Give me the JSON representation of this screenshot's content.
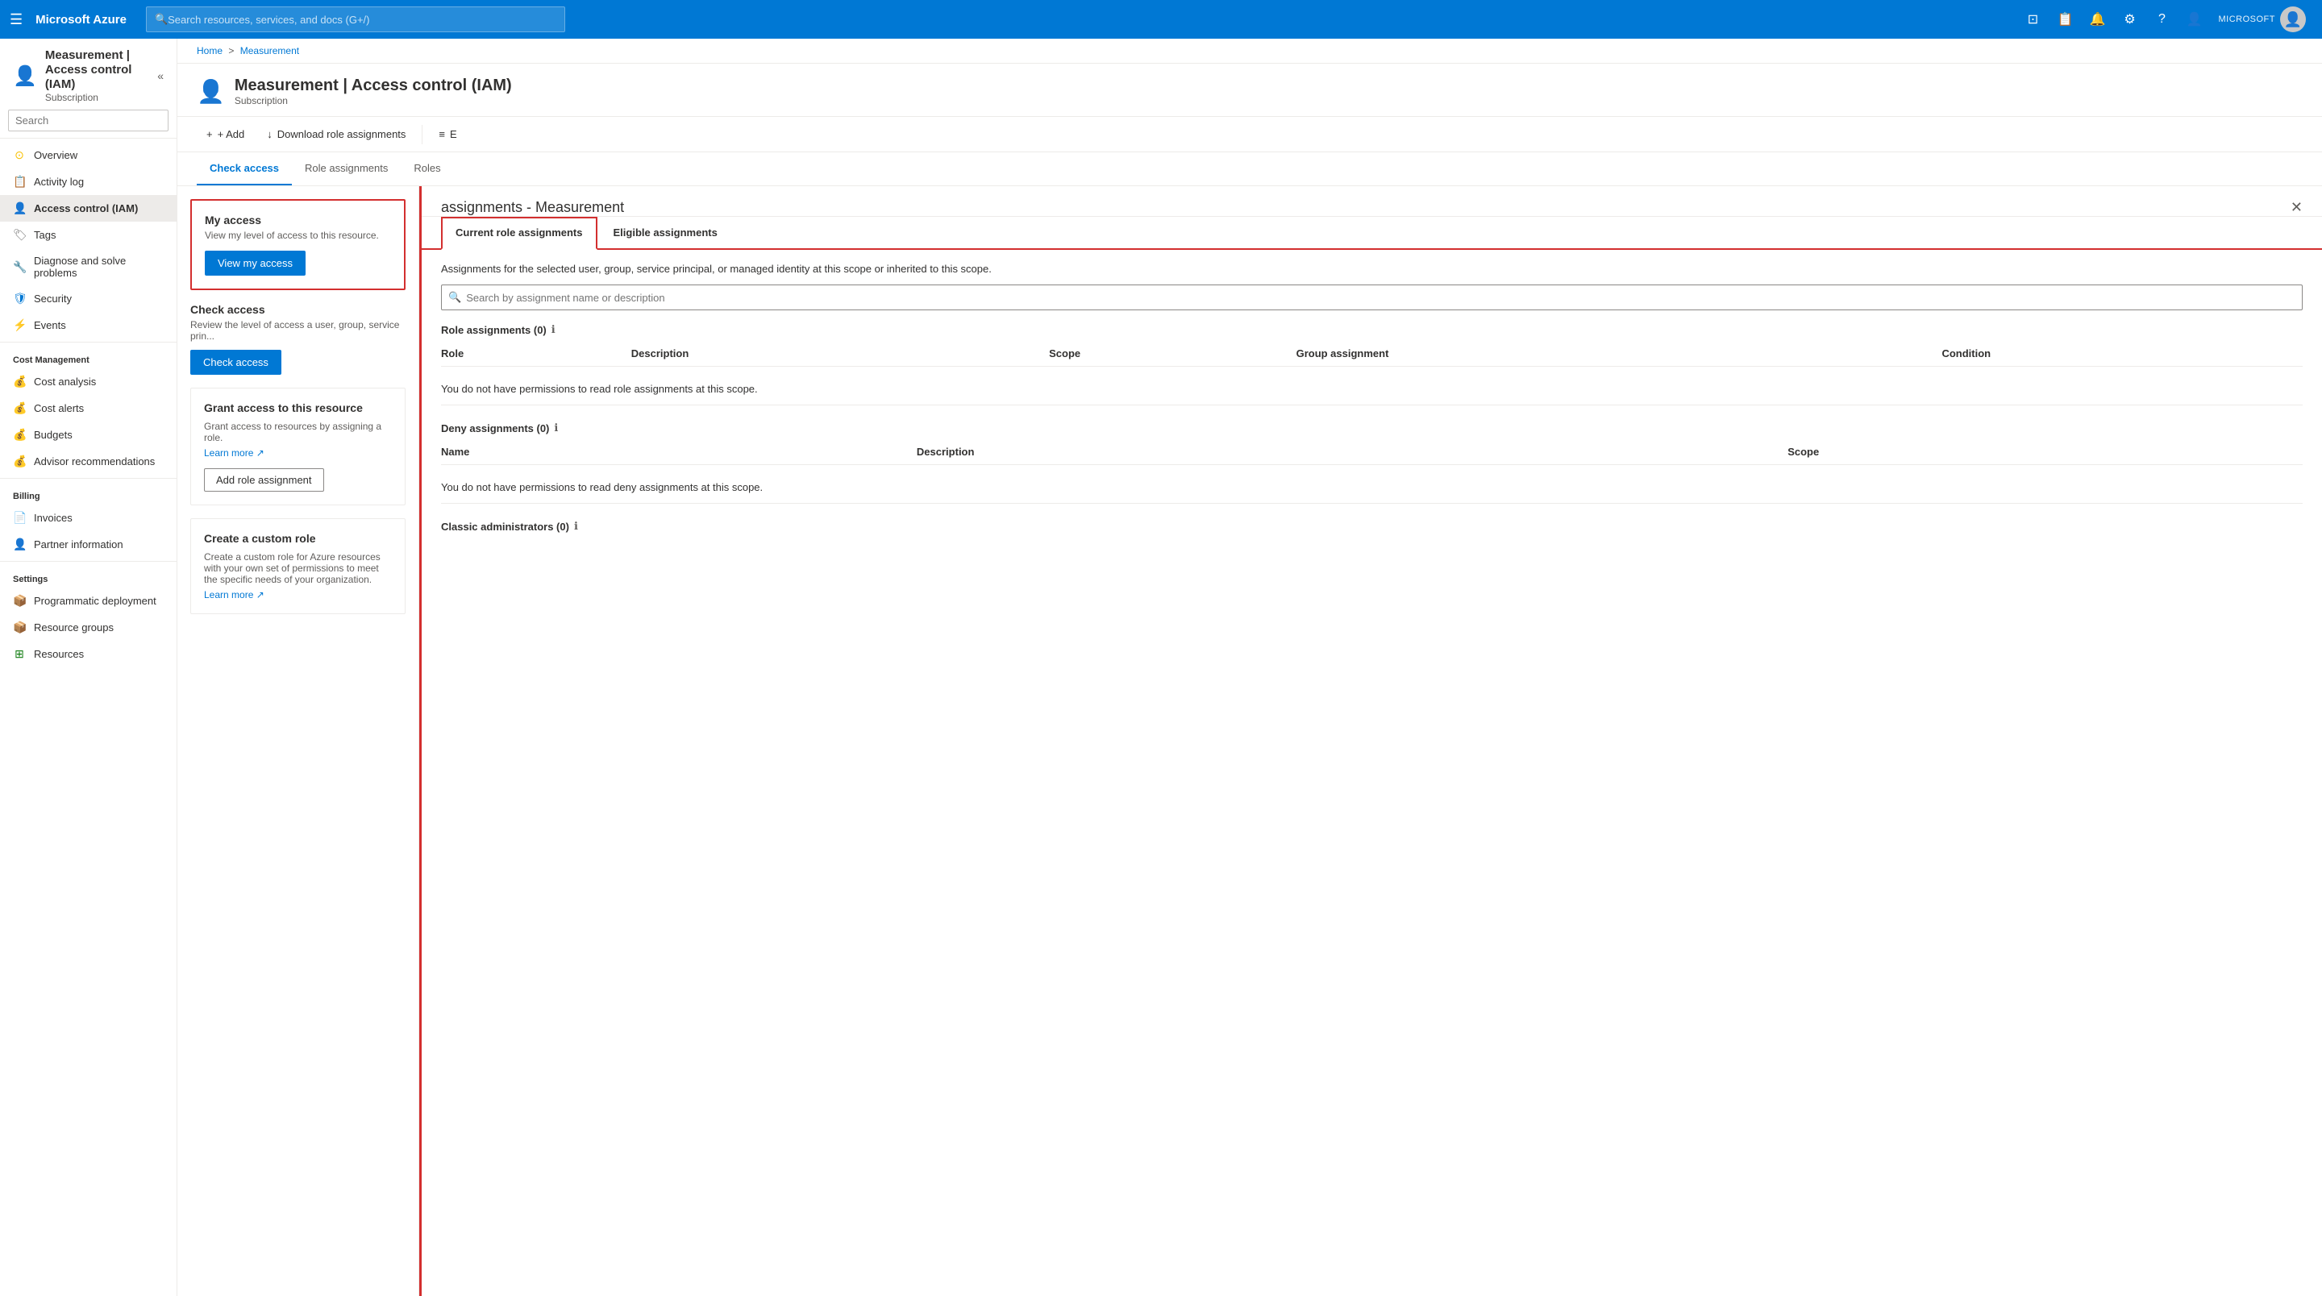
{
  "topnav": {
    "hamburger": "☰",
    "logo": "Microsoft Azure",
    "search_placeholder": "Search resources, services, and docs (G+/)",
    "icons": [
      "⊡",
      "📋",
      "🔔",
      "⚙",
      "?",
      "👤"
    ],
    "user_label": "MICROSOFT",
    "avatar_char": "👤"
  },
  "breadcrumb": {
    "home": "Home",
    "separator": ">",
    "resource": "Measurement"
  },
  "sidebar": {
    "resource_icon": "👤",
    "resource_name": "Measurement | Access control (IAM)",
    "resource_type": "Subscription",
    "search_placeholder": "Search",
    "collapse_icon": "«",
    "nav_items": [
      {
        "id": "overview",
        "label": "Overview",
        "icon": "⊙",
        "icon_color": "#f8c000"
      },
      {
        "id": "activity-log",
        "label": "Activity log",
        "icon": "📋",
        "icon_color": "#0078d4"
      },
      {
        "id": "iam",
        "label": "Access control (IAM)",
        "icon": "👤",
        "icon_color": "#0078d4",
        "active": true
      },
      {
        "id": "tags",
        "label": "Tags",
        "icon": "🏷",
        "icon_color": "#7a7a7a"
      },
      {
        "id": "diagnose",
        "label": "Diagnose and solve problems",
        "icon": "🔧",
        "icon_color": "#7a7a7a"
      },
      {
        "id": "security",
        "label": "Security",
        "icon": "🛡",
        "icon_color": "#0078d4"
      },
      {
        "id": "events",
        "label": "Events",
        "icon": "⚡",
        "icon_color": "#f8c000"
      }
    ],
    "sections": [
      {
        "label": "Cost Management",
        "items": [
          {
            "id": "cost-analysis",
            "label": "Cost analysis",
            "icon": "💰",
            "icon_color": "#107c10"
          },
          {
            "id": "cost-alerts",
            "label": "Cost alerts",
            "icon": "💰",
            "icon_color": "#107c10"
          },
          {
            "id": "budgets",
            "label": "Budgets",
            "icon": "💰",
            "icon_color": "#107c10"
          },
          {
            "id": "advisor",
            "label": "Advisor recommendations",
            "icon": "💰",
            "icon_color": "#107c10"
          }
        ]
      },
      {
        "label": "Billing",
        "items": [
          {
            "id": "invoices",
            "label": "Invoices",
            "icon": "📄",
            "icon_color": "#0078d4"
          },
          {
            "id": "partner-info",
            "label": "Partner information",
            "icon": "👤",
            "icon_color": "#7a7a7a"
          }
        ]
      },
      {
        "label": "Settings",
        "items": [
          {
            "id": "programmatic",
            "label": "Programmatic deployment",
            "icon": "📦",
            "icon_color": "#0078d4"
          },
          {
            "id": "resource-groups",
            "label": "Resource groups",
            "icon": "📦",
            "icon_color": "#0078d4"
          },
          {
            "id": "resources",
            "label": "Resources",
            "icon": "⊞",
            "icon_color": "#107c10"
          }
        ]
      }
    ]
  },
  "toolbar": {
    "add_label": "+ Add",
    "download_label": "↓ Download role assignments",
    "more_label": "≡ E"
  },
  "tabs": {
    "items": [
      {
        "id": "check-access",
        "label": "Check access",
        "active": true
      },
      {
        "id": "role-assignments",
        "label": "Role assignments",
        "active": false
      },
      {
        "id": "roles",
        "label": "Roles",
        "active": false
      }
    ]
  },
  "myaccess": {
    "title": "My access",
    "description": "View my level of access to this resource.",
    "button_label": "View my access"
  },
  "checkaccess": {
    "title": "Check access",
    "description": "Review the level of access a user, group, service prin...",
    "button_label": "Check access"
  },
  "grantaccess": {
    "title": "Grant access to this resource",
    "description": "Grant access to resources by assigning a role.",
    "learn_more": "Learn more",
    "button_label": "Add role assignment"
  },
  "customrole": {
    "title": "Create a custom role",
    "description": "Create a custom role for Azure resources with your own set of permissions to meet the specific needs of your organization.",
    "learn_more": "Learn more"
  },
  "rightpanel": {
    "title": "assignments - Measurement",
    "close_icon": "✕",
    "tabs": [
      {
        "id": "current",
        "label": "Current role assignments",
        "active": true
      },
      {
        "id": "eligible",
        "label": "Eligible assignments",
        "active": false
      }
    ],
    "description": "Assignments for the selected user, group, service principal, or managed identity at this scope or inherited to this scope.",
    "search_placeholder": "Search by assignment name or description",
    "role_assignments": {
      "label": "Role assignments (0)",
      "tooltip": "ℹ",
      "columns": [
        "Role",
        "Description",
        "Scope",
        "Group assignment",
        "Condition"
      ],
      "empty_message": "You do not have permissions to read role assignments at this scope."
    },
    "deny_assignments": {
      "label": "Deny assignments (0)",
      "tooltip": "ℹ",
      "columns": [
        "Name",
        "Description",
        "Scope"
      ],
      "empty_message": "You do not have permissions to read deny assignments at this scope."
    },
    "classic_admins": {
      "label": "Classic administrators (0)",
      "tooltip": "ℹ"
    }
  }
}
